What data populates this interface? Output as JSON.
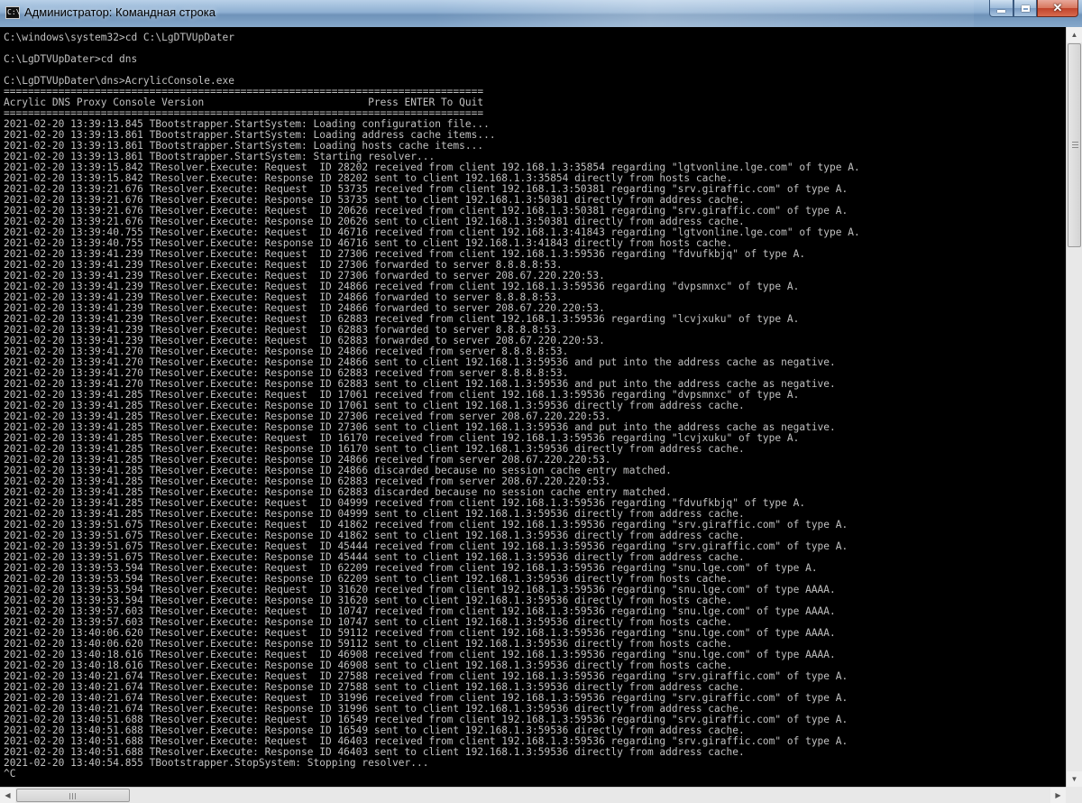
{
  "window": {
    "title": "Администратор: Командная строка",
    "icon_text": "C:\\",
    "controls": {
      "minimize": "minimize-icon",
      "maximize": "maximize-icon",
      "close": "close-icon"
    }
  },
  "console": {
    "lines": [
      "C:\\windows\\system32>cd C:\\LgDTVUpDater",
      "",
      "C:\\LgDTVUpDater>cd dns",
      "",
      "C:\\LgDTVUpDater\\dns>AcrylicConsole.exe",
      "===============================================================================",
      "Acrylic DNS Proxy Console Version                           Press ENTER To Quit",
      "===============================================================================",
      "2021-02-20 13:39:13.845 TBootstrapper.StartSystem: Loading configuration file...",
      "2021-02-20 13:39:13.861 TBootstrapper.StartSystem: Loading address cache items...",
      "2021-02-20 13:39:13.861 TBootstrapper.StartSystem: Loading hosts cache items...",
      "2021-02-20 13:39:13.861 TBootstrapper.StartSystem: Starting resolver...",
      "2021-02-20 13:39:15.842 TResolver.Execute: Request  ID 28202 received from client 192.168.1.3:35854 regarding \"lgtvonline.lge.com\" of type A.",
      "2021-02-20 13:39:15.842 TResolver.Execute: Response ID 28202 sent to client 192.168.1.3:35854 directly from hosts cache.",
      "2021-02-20 13:39:21.676 TResolver.Execute: Request  ID 53735 received from client 192.168.1.3:50381 regarding \"srv.giraffic.com\" of type A.",
      "2021-02-20 13:39:21.676 TResolver.Execute: Response ID 53735 sent to client 192.168.1.3:50381 directly from address cache.",
      "2021-02-20 13:39:21.676 TResolver.Execute: Request  ID 20626 received from client 192.168.1.3:50381 regarding \"srv.giraffic.com\" of type A.",
      "2021-02-20 13:39:21.676 TResolver.Execute: Response ID 20626 sent to client 192.168.1.3:50381 directly from address cache.",
      "2021-02-20 13:39:40.755 TResolver.Execute: Request  ID 46716 received from client 192.168.1.3:41843 regarding \"lgtvonline.lge.com\" of type A.",
      "2021-02-20 13:39:40.755 TResolver.Execute: Response ID 46716 sent to client 192.168.1.3:41843 directly from hosts cache.",
      "2021-02-20 13:39:41.239 TResolver.Execute: Request  ID 27306 received from client 192.168.1.3:59536 regarding \"fdvufkbjq\" of type A.",
      "2021-02-20 13:39:41.239 TResolver.Execute: Request  ID 27306 forwarded to server 8.8.8.8:53.",
      "2021-02-20 13:39:41.239 TResolver.Execute: Request  ID 27306 forwarded to server 208.67.220.220:53.",
      "2021-02-20 13:39:41.239 TResolver.Execute: Request  ID 24866 received from client 192.168.1.3:59536 regarding \"dvpsmnxc\" of type A.",
      "2021-02-20 13:39:41.239 TResolver.Execute: Request  ID 24866 forwarded to server 8.8.8.8:53.",
      "2021-02-20 13:39:41.239 TResolver.Execute: Request  ID 24866 forwarded to server 208.67.220.220:53.",
      "2021-02-20 13:39:41.239 TResolver.Execute: Request  ID 62883 received from client 192.168.1.3:59536 regarding \"lcvjxuku\" of type A.",
      "2021-02-20 13:39:41.239 TResolver.Execute: Request  ID 62883 forwarded to server 8.8.8.8:53.",
      "2021-02-20 13:39:41.239 TResolver.Execute: Request  ID 62883 forwarded to server 208.67.220.220:53.",
      "2021-02-20 13:39:41.270 TResolver.Execute: Response ID 24866 received from server 8.8.8.8:53.",
      "2021-02-20 13:39:41.270 TResolver.Execute: Response ID 24866 sent to client 192.168.1.3:59536 and put into the address cache as negative.",
      "2021-02-20 13:39:41.270 TResolver.Execute: Response ID 62883 received from server 8.8.8.8:53.",
      "2021-02-20 13:39:41.270 TResolver.Execute: Response ID 62883 sent to client 192.168.1.3:59536 and put into the address cache as negative.",
      "2021-02-20 13:39:41.285 TResolver.Execute: Request  ID 17061 received from client 192.168.1.3:59536 regarding \"dvpsmnxc\" of type A.",
      "2021-02-20 13:39:41.285 TResolver.Execute: Response ID 17061 sent to client 192.168.1.3:59536 directly from address cache.",
      "2021-02-20 13:39:41.285 TResolver.Execute: Response ID 27306 received from server 208.67.220.220:53.",
      "2021-02-20 13:39:41.285 TResolver.Execute: Response ID 27306 sent to client 192.168.1.3:59536 and put into the address cache as negative.",
      "2021-02-20 13:39:41.285 TResolver.Execute: Request  ID 16170 received from client 192.168.1.3:59536 regarding \"lcvjxuku\" of type A.",
      "2021-02-20 13:39:41.285 TResolver.Execute: Response ID 16170 sent to client 192.168.1.3:59536 directly from address cache.",
      "2021-02-20 13:39:41.285 TResolver.Execute: Response ID 24866 received from server 208.67.220.220:53.",
      "2021-02-20 13:39:41.285 TResolver.Execute: Response ID 24866 discarded because no session cache entry matched.",
      "2021-02-20 13:39:41.285 TResolver.Execute: Response ID 62883 received from server 208.67.220.220:53.",
      "2021-02-20 13:39:41.285 TResolver.Execute: Response ID 62883 discarded because no session cache entry matched.",
      "2021-02-20 13:39:41.285 TResolver.Execute: Request  ID 04999 received from client 192.168.1.3:59536 regarding \"fdvufkbjq\" of type A.",
      "2021-02-20 13:39:41.285 TResolver.Execute: Response ID 04999 sent to client 192.168.1.3:59536 directly from address cache.",
      "2021-02-20 13:39:51.675 TResolver.Execute: Request  ID 41862 received from client 192.168.1.3:59536 regarding \"srv.giraffic.com\" of type A.",
      "2021-02-20 13:39:51.675 TResolver.Execute: Response ID 41862 sent to client 192.168.1.3:59536 directly from address cache.",
      "2021-02-20 13:39:51.675 TResolver.Execute: Request  ID 45444 received from client 192.168.1.3:59536 regarding \"srv.giraffic.com\" of type A.",
      "2021-02-20 13:39:51.675 TResolver.Execute: Response ID 45444 sent to client 192.168.1.3:59536 directly from address cache.",
      "2021-02-20 13:39:53.594 TResolver.Execute: Request  ID 62209 received from client 192.168.1.3:59536 regarding \"snu.lge.com\" of type A.",
      "2021-02-20 13:39:53.594 TResolver.Execute: Response ID 62209 sent to client 192.168.1.3:59536 directly from hosts cache.",
      "2021-02-20 13:39:53.594 TResolver.Execute: Request  ID 31620 received from client 192.168.1.3:59536 regarding \"snu.lge.com\" of type AAAA.",
      "2021-02-20 13:39:53.594 TResolver.Execute: Response ID 31620 sent to client 192.168.1.3:59536 directly from hosts cache.",
      "2021-02-20 13:39:57.603 TResolver.Execute: Request  ID 10747 received from client 192.168.1.3:59536 regarding \"snu.lge.com\" of type AAAA.",
      "2021-02-20 13:39:57.603 TResolver.Execute: Response ID 10747 sent to client 192.168.1.3:59536 directly from hosts cache.",
      "2021-02-20 13:40:06.620 TResolver.Execute: Request  ID 59112 received from client 192.168.1.3:59536 regarding \"snu.lge.com\" of type AAAA.",
      "2021-02-20 13:40:06.620 TResolver.Execute: Response ID 59112 sent to client 192.168.1.3:59536 directly from hosts cache.",
      "2021-02-20 13:40:18.616 TResolver.Execute: Request  ID 46908 received from client 192.168.1.3:59536 regarding \"snu.lge.com\" of type AAAA.",
      "2021-02-20 13:40:18.616 TResolver.Execute: Response ID 46908 sent to client 192.168.1.3:59536 directly from hosts cache.",
      "2021-02-20 13:40:21.674 TResolver.Execute: Request  ID 27588 received from client 192.168.1.3:59536 regarding \"srv.giraffic.com\" of type A.",
      "2021-02-20 13:40:21.674 TResolver.Execute: Response ID 27588 sent to client 192.168.1.3:59536 directly from address cache.",
      "2021-02-20 13:40:21.674 TResolver.Execute: Request  ID 31996 received from client 192.168.1.3:59536 regarding \"srv.giraffic.com\" of type A.",
      "2021-02-20 13:40:21.674 TResolver.Execute: Response ID 31996 sent to client 192.168.1.3:59536 directly from address cache.",
      "2021-02-20 13:40:51.688 TResolver.Execute: Request  ID 16549 received from client 192.168.1.3:59536 regarding \"srv.giraffic.com\" of type A.",
      "2021-02-20 13:40:51.688 TResolver.Execute: Response ID 16549 sent to client 192.168.1.3:59536 directly from address cache.",
      "2021-02-20 13:40:51.688 TResolver.Execute: Request  ID 46403 received from client 192.168.1.3:59536 regarding \"srv.giraffic.com\" of type A.",
      "2021-02-20 13:40:51.688 TResolver.Execute: Response ID 46403 sent to client 192.168.1.3:59536 directly from address cache.",
      "2021-02-20 13:40:54.855 TBootstrapper.StopSystem: Stopping resolver...",
      "^C"
    ]
  },
  "scrollbars": {
    "vertical": {
      "up_icon": "arrow-up-icon",
      "down_icon": "arrow-down-icon"
    },
    "horizontal": {
      "left_icon": "arrow-left-icon",
      "right_icon": "arrow-right-icon"
    }
  },
  "colors": {
    "console_bg": "#000000",
    "console_fg": "#c0c0c0",
    "titlebar": "#8fb0d2",
    "close_button": "#c0432b"
  }
}
